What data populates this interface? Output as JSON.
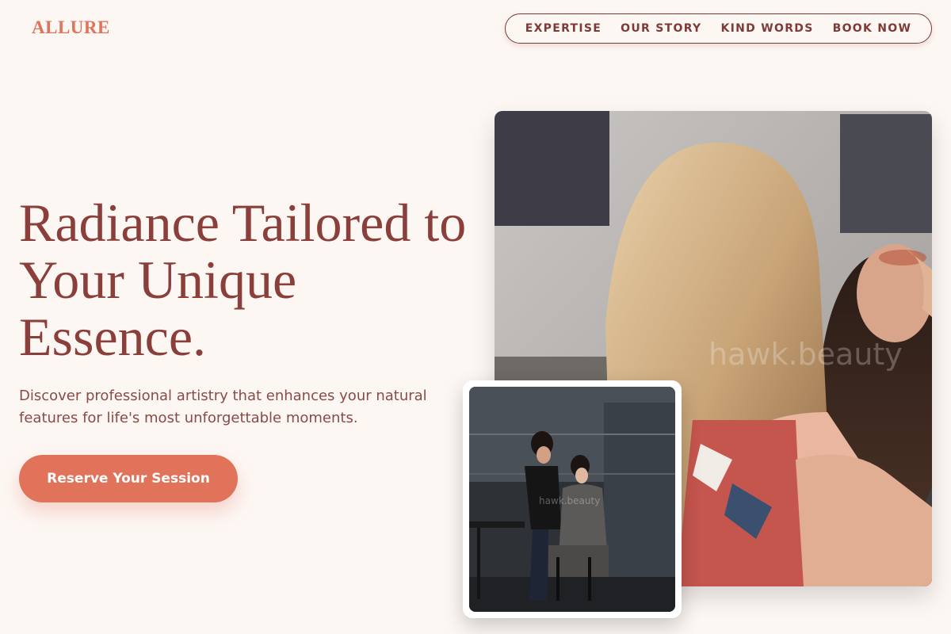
{
  "brand": {
    "logo": "ALLURE"
  },
  "nav": {
    "items": [
      "EXPERTISE",
      "OUR STORY",
      "KIND WORDS",
      "BOOK NOW"
    ]
  },
  "hero": {
    "headline": "Radiance Tailored to Your Unique Essence.",
    "subtext": "Discover professional artistry that enhances your natural features for life's most unforgettable moments.",
    "cta_label": "Reserve Your Session"
  },
  "images": {
    "main_watermark": "hawk.beauty",
    "inset_watermark": "hawk.beauty"
  },
  "colors": {
    "background": "#fdf7f4",
    "accent": "#e0735a",
    "text_primary": "#8a3f3b"
  }
}
